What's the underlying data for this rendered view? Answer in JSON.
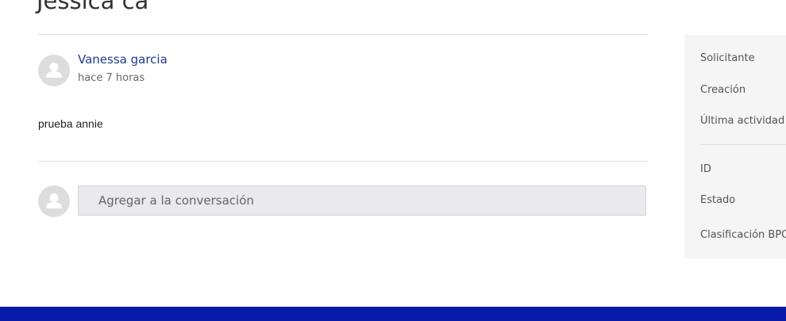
{
  "request": {
    "title": "Jessica ca"
  },
  "comment": {
    "author": "Vanessa garcia",
    "timestamp": "hace 7 horas",
    "body": "prueba annie",
    "avatar_icon": "user-icon"
  },
  "reply": {
    "placeholder": "Agregar a la conversación",
    "avatar_icon": "user-icon"
  },
  "sidebar": {
    "labels": {
      "requester": "Solicitante",
      "created": "Creación",
      "last_activity": "Última actividad",
      "id": "ID",
      "status": "Estado",
      "classification": "Clasificación BPO"
    }
  },
  "colors": {
    "link": "#1f3a93",
    "footer": "#0a1aa8",
    "sidebar_bg": "#f5f5f5",
    "input_bg": "#e9e9ee"
  }
}
